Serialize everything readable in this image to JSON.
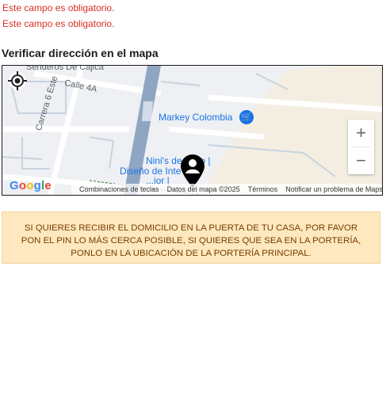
{
  "errors": [
    "Este campo es obligatorio.",
    "Este campo es obligatorio."
  ],
  "map": {
    "title": "Verificar dirección en el mapa",
    "streets": {
      "senderos": "Senderos De Cajicá",
      "calle4a": "Calle 4A",
      "carrera6": "Carrera 6 Este"
    },
    "pois": {
      "markey": "Markey Colombia",
      "ninis_line1": "Nini's de",
      "ninis_line1b": "io |",
      "ninis_line2": "Diseño de Inte",
      "ninis_line3": "...ior |"
    },
    "zoom_in": "+",
    "zoom_out": "−",
    "logo": "Google",
    "attribution": {
      "shortcuts": "Combinaciones de teclas",
      "data": "Datos del mapa ©2025",
      "terms": "Términos",
      "report": "Notificar un problema de Maps"
    }
  },
  "notice": "SI QUIERES RECIBIR EL DOMICILIO EN LA PUERTA DE TU CASA, POR FAVOR PON EL PIN LO MÁS CERCA POSIBLE, SI QUIERES QUE SEA EN LA PORTERÍA, PONLO EN LA UBICACIÓN DE LA PORTERÍA PRINCIPAL.",
  "colors": {
    "error": "#d93025",
    "notice_bg": "#fde8bf",
    "notice_text": "#7a3d00",
    "poi": "#1a73e8"
  }
}
